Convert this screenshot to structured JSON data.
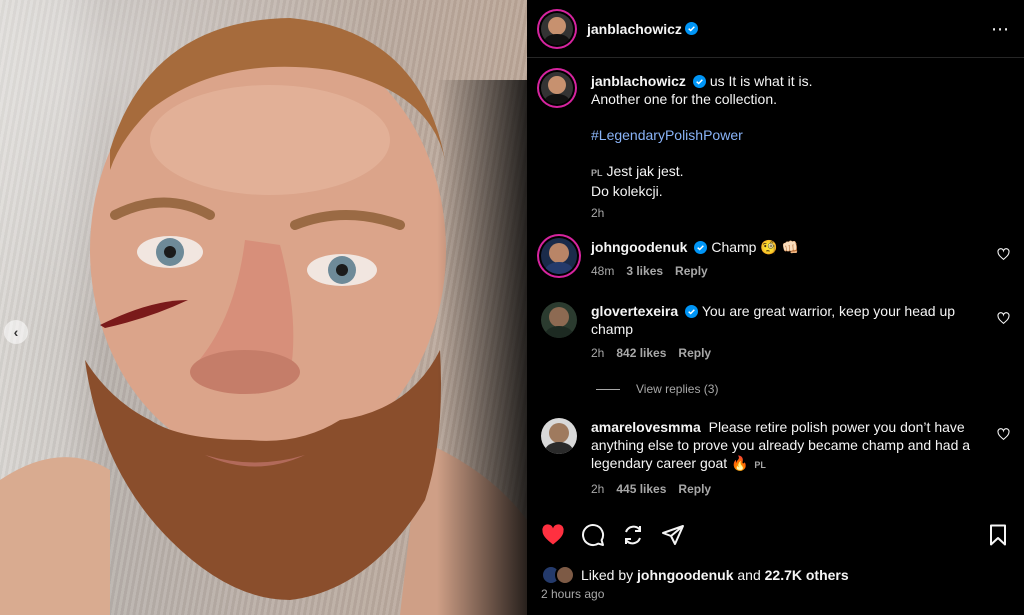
{
  "post": {
    "author": "janblachowicz",
    "caption_lead": "us It is what it is.",
    "caption_line2": "Another one for the collection.",
    "hashtag": "#LegendaryPolishPower",
    "translation_tag": "PL",
    "translation_line1": "Jest jak jest.",
    "translation_line2": "Do kolekcji.",
    "caption_time": "2h",
    "more_icon": "⋯"
  },
  "comments": [
    {
      "user": "johngoodenuk",
      "text": "Champ 🧐 👊🏻",
      "time": "48m",
      "likes": "3 likes",
      "reply": "Reply"
    },
    {
      "user": "glovertexeira",
      "text": "You are great warrior, keep your head up champ",
      "time": "2h",
      "likes": "842 likes",
      "reply": "Reply",
      "view_replies": "View replies (3)"
    },
    {
      "user": "amarelovesmma",
      "text": "Please retire polish power you don’t have anything else to prove you already became champ and had a legendary career goat 🔥",
      "tag": "PL",
      "time": "2h",
      "likes": "445 likes",
      "reply": "Reply"
    }
  ],
  "footer": {
    "liked_prefix": "Liked by",
    "liked_user": "johngoodenuk",
    "liked_and": "and",
    "liked_count": "22.7K others",
    "posted": "2 hours ago"
  },
  "icons": {
    "like": "heart-icon",
    "comment": "comment-icon",
    "repost": "repost-icon",
    "share": "share-icon",
    "save": "bookmark-icon"
  },
  "colors": {
    "like_active": "#ff3040",
    "verified": "#0095f6",
    "hashtag": "#8ab4f8"
  }
}
